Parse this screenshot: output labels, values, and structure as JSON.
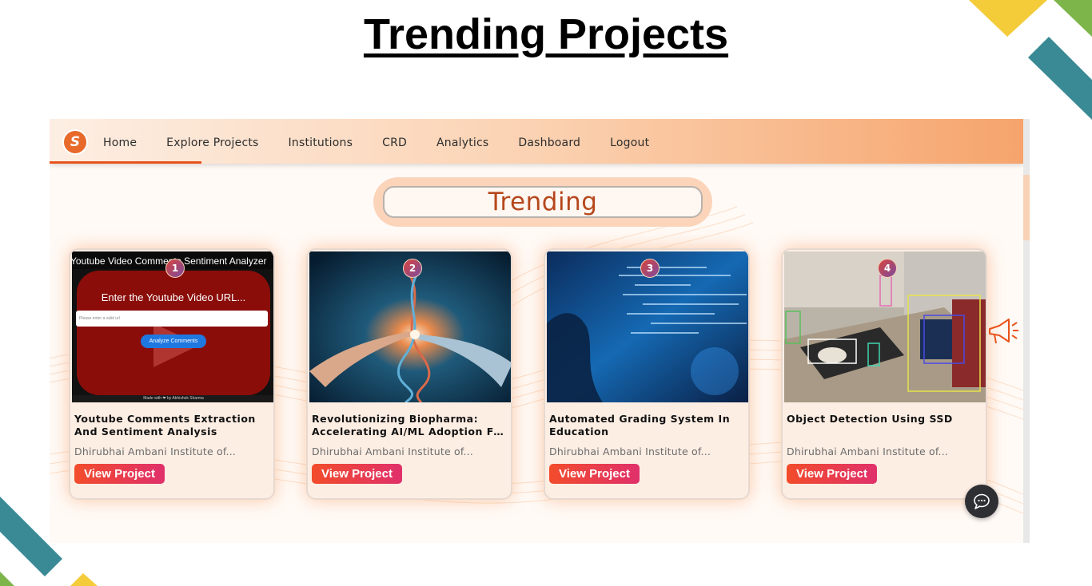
{
  "slide": {
    "title": "Trending Projects"
  },
  "nav": {
    "logo_text": "S",
    "items": [
      {
        "label": "Home"
      },
      {
        "label": "Explore Projects"
      },
      {
        "label": "Institutions"
      },
      {
        "label": "CRD"
      },
      {
        "label": "Analytics"
      },
      {
        "label": "Dashboard"
      },
      {
        "label": "Logout"
      }
    ],
    "active": "Explore Projects"
  },
  "trending": {
    "label": "Trending"
  },
  "cards": [
    {
      "rank": "1",
      "title_line1": "Youtube Comments Extraction",
      "title_line2": "And Sentiment Analysis",
      "institution": "Dhirubhai Ambani Institute of...",
      "button": "View Project",
      "thumb": {
        "heading": "Youtube Video Comments Sentiment Analyzer",
        "prompt": "Enter the Youtube Video URL...",
        "input_placeholder": "Please enter a valid url",
        "button": "Analyze Comments",
        "footer": "Made with ❤ by Abhishek Sharma"
      }
    },
    {
      "rank": "2",
      "title_line1": "Revolutionizing Biopharma:",
      "title_line2": "Accelerating AI/ML Adoption Fo...",
      "institution": "Dhirubhai Ambani Institute of...",
      "button": "View Project"
    },
    {
      "rank": "3",
      "title_line1": "Automated Grading System In",
      "title_line2": "Education",
      "institution": "Dhirubhai Ambani Institute of...",
      "button": "View Project"
    },
    {
      "rank": "4",
      "title_line1": "Object Detection Using SSD",
      "title_line2": "",
      "institution": "Dhirubhai Ambani Institute of...",
      "button": "View Project"
    }
  ],
  "icons": {
    "logo": "logo-icon",
    "chat": "chat-icon",
    "megaphone": "megaphone-icon"
  },
  "colors": {
    "accent": "#e8531c",
    "trending_text": "#b5471c",
    "button_start": "#f24c2b",
    "button_end": "#e0306b",
    "deco_teal": "#3a8a96",
    "deco_yellow": "#f4cc3a",
    "deco_green": "#7db54a"
  }
}
